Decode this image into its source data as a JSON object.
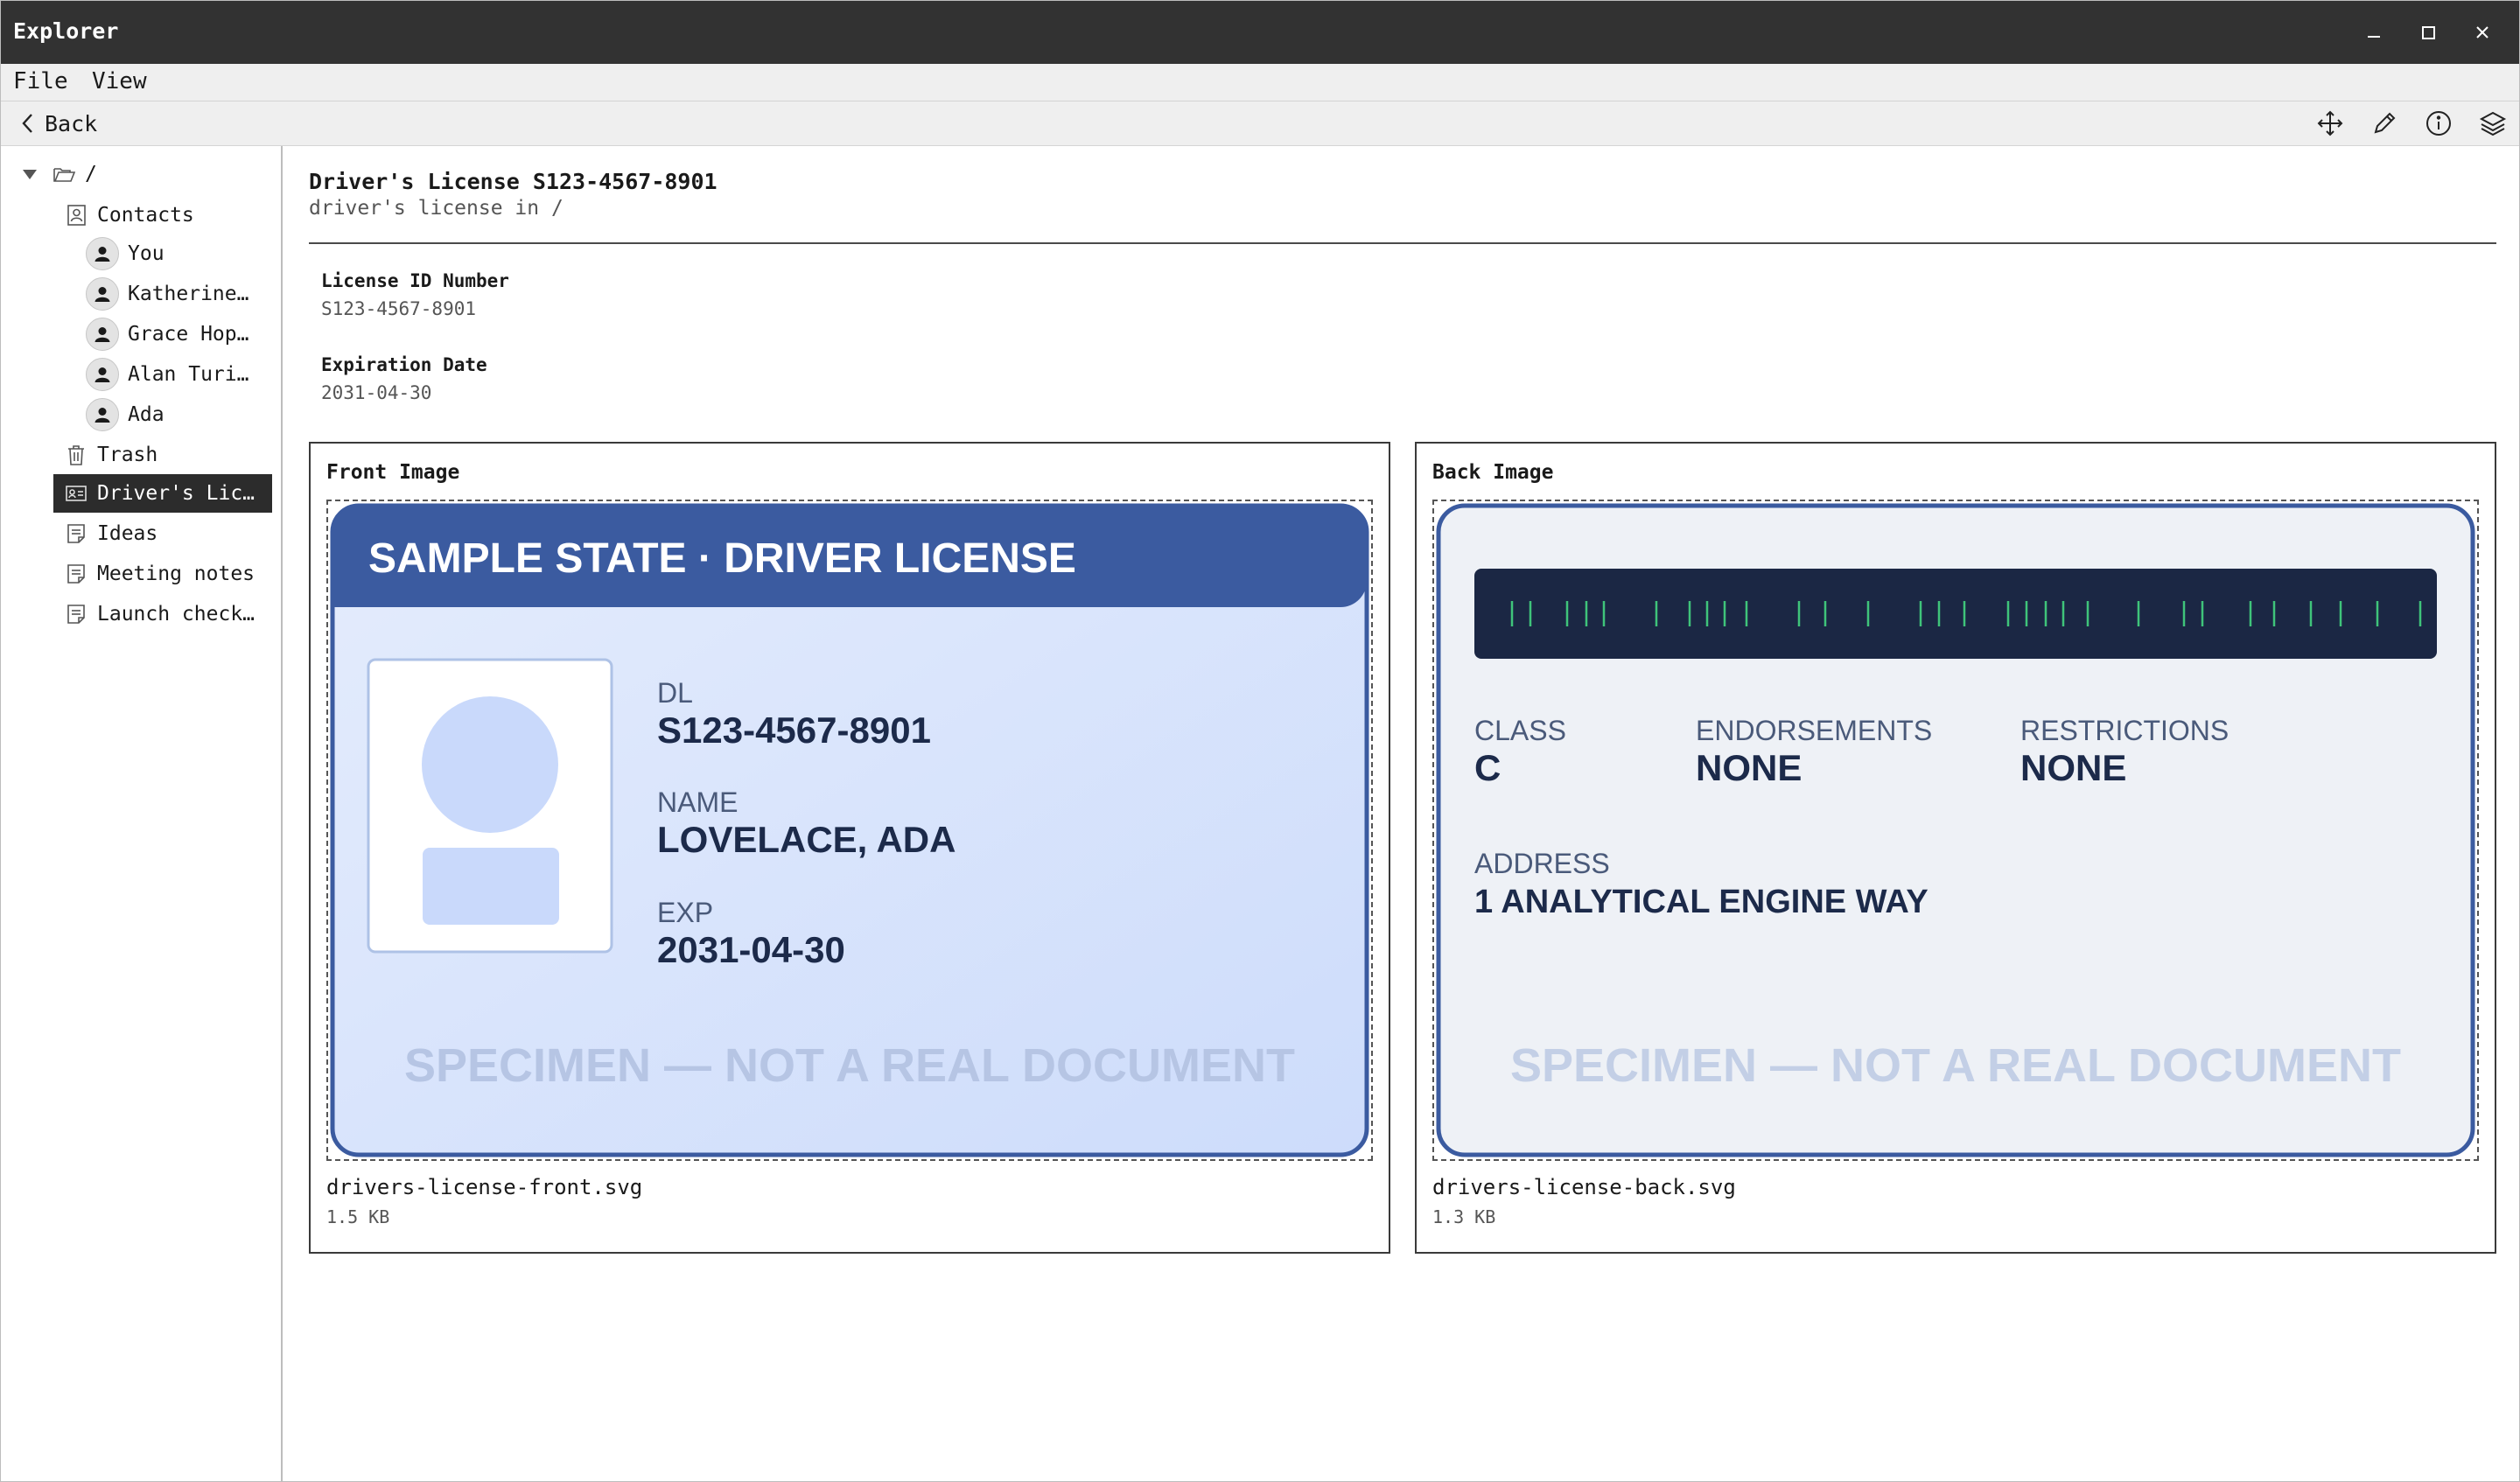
{
  "window": {
    "title": "Explorer"
  },
  "menu": {
    "file": "File",
    "view": "View"
  },
  "toolbar": {
    "back_label": "Back"
  },
  "sidebar": {
    "root": "/",
    "items": [
      {
        "label": "Contacts"
      },
      {
        "label": "You"
      },
      {
        "label": "Katherine…"
      },
      {
        "label": "Grace Hop…"
      },
      {
        "label": "Alan Turi…"
      },
      {
        "label": "Ada"
      },
      {
        "label": "Trash"
      },
      {
        "label": "Driver's Lic…"
      },
      {
        "label": "Ideas"
      },
      {
        "label": "Meeting notes"
      },
      {
        "label": "Launch check…"
      }
    ]
  },
  "document": {
    "title": "Driver's License S123-4567-8901",
    "subtitle": "driver's license in /",
    "fields": [
      {
        "label": "License ID Number",
        "value": "S123-4567-8901"
      },
      {
        "label": "Expiration Date",
        "value": "2031-04-30"
      }
    ]
  },
  "front": {
    "panel_title": "Front Image",
    "file_name": "drivers-license-front.svg",
    "file_size": "1.5 KB",
    "card": {
      "header": "SAMPLE STATE · DRIVER LICENSE",
      "dl_label": "DL",
      "dl_value": "S123-4567-8901",
      "name_label": "NAME",
      "name_value": "LOVELACE, ADA",
      "exp_label": "EXP",
      "exp_value": "2031-04-30",
      "watermark": "SPECIMEN — NOT A REAL DOCUMENT"
    }
  },
  "back": {
    "panel_title": "Back Image",
    "file_name": "drivers-license-back.svg",
    "file_size": "1.3 KB",
    "card": {
      "class_label": "CLASS",
      "class_value": "C",
      "endorsements_label": "ENDORSEMENTS",
      "endorsements_value": "NONE",
      "restrictions_label": "RESTRICTIONS",
      "restrictions_value": "NONE",
      "address_label": "ADDRESS",
      "address_value": "1 ANALYTICAL ENGINE WAY",
      "watermark": "SPECIMEN — NOT A REAL DOCUMENT"
    }
  },
  "colors": {
    "titlebar": "#323232",
    "card_header": "#3b5ba0",
    "card_border": "#3b5ba0",
    "front_bg_top": "#e4ecfc",
    "front_bg_bottom": "#cddcfb",
    "back_bg": "#eef1f6",
    "stripe": "#1b2744",
    "stripe_ticks": "#3fc47a",
    "card_text": "#1c2a4a",
    "card_label": "#4a5a7a",
    "watermark": "#b6c5e4"
  }
}
